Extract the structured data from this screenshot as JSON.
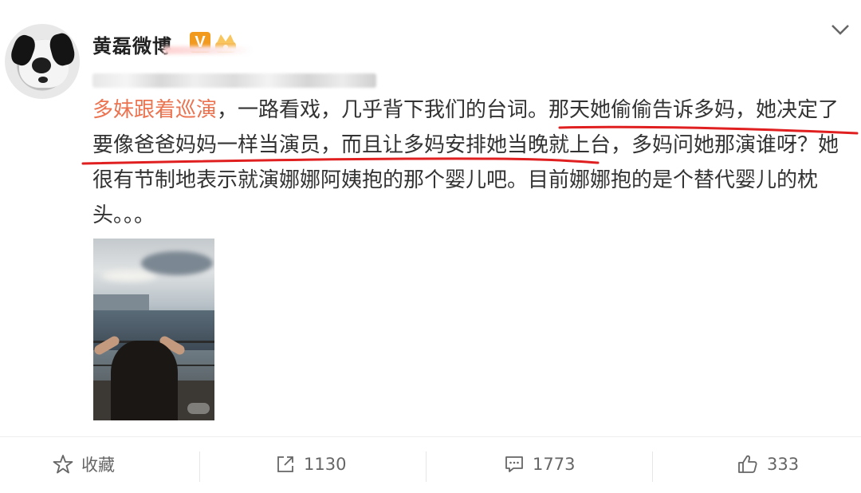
{
  "header": {
    "username": "黄磊微博",
    "verified_badge": "V",
    "badge_color": "#f29a1e"
  },
  "post": {
    "tag": "多妹跟着巡演",
    "text": "，一路看戏，几乎背下我们的台词。那天她偷偷告诉多妈，她决定了要像爸爸妈妈一样当演员，而且让多妈安排她当晚就上台，多妈问她那演谁呀？她很有节制地表示就演娜娜阿姨抱的那个婴儿吧。目前娜娜抱的是个替代婴儿的枕头。。。",
    "tag_color": "#eb7350",
    "underline_color": "#e02020"
  },
  "actions": {
    "favorite": {
      "label": "收藏",
      "icon": "star-outline-icon"
    },
    "repost": {
      "count": "1130",
      "icon": "share-arrow-icon"
    },
    "comment": {
      "count": "1773",
      "icon": "comment-icon"
    },
    "like": {
      "count": "333",
      "icon": "thumbs-up-icon"
    }
  },
  "colors": {
    "text": "#333333",
    "action_text": "#666666"
  }
}
